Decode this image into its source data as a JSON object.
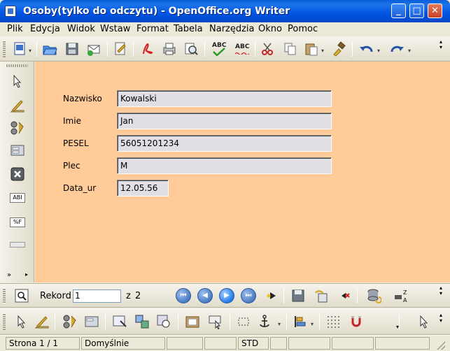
{
  "window": {
    "title": "Osoby(tylko do odczytu) - OpenOffice.org Writer",
    "minimize": "_",
    "maximize": "□",
    "close": "✕"
  },
  "menu": {
    "items": [
      "Plik",
      "Edycja",
      "Widok",
      "Wstaw",
      "Format",
      "Tabela",
      "Narzędzia",
      "Okno",
      "Pomoc"
    ]
  },
  "toolbar": {
    "icons": [
      "edit-file-icon",
      "open-folder-icon",
      "save-icon",
      "email-icon",
      "edit-document-icon",
      "export-pdf-icon",
      "print-icon",
      "page-preview-icon",
      "spellcheck-icon",
      "autospellcheck-icon",
      "cut-icon",
      "copy-icon",
      "paste-icon",
      "format-paintbrush-icon",
      "undo-icon",
      "redo-icon"
    ],
    "spell_label": "ABC",
    "spell2_label": "ABC"
  },
  "form": {
    "fields": [
      {
        "label": "Nazwisko",
        "value": "Kowalski"
      },
      {
        "label": "Imie",
        "value": "Jan"
      },
      {
        "label": "PESEL",
        "value": "56051201234"
      },
      {
        "label": "Plec",
        "value": "M"
      },
      {
        "label": "Data_ur",
        "value": "12.05.56"
      }
    ]
  },
  "navigation": {
    "record_label": "Rekord",
    "record_value": "1",
    "of_label": "z",
    "total": "2"
  },
  "left_toolbar": {
    "text_abl": "ABI",
    "text_pct": "%F"
  },
  "status": {
    "page": "Strona  1 / 1",
    "style": "Domyślnie",
    "mode": "STD"
  },
  "colors": {
    "form_background": "#ffcc99",
    "titlebar": "#0054e3"
  }
}
